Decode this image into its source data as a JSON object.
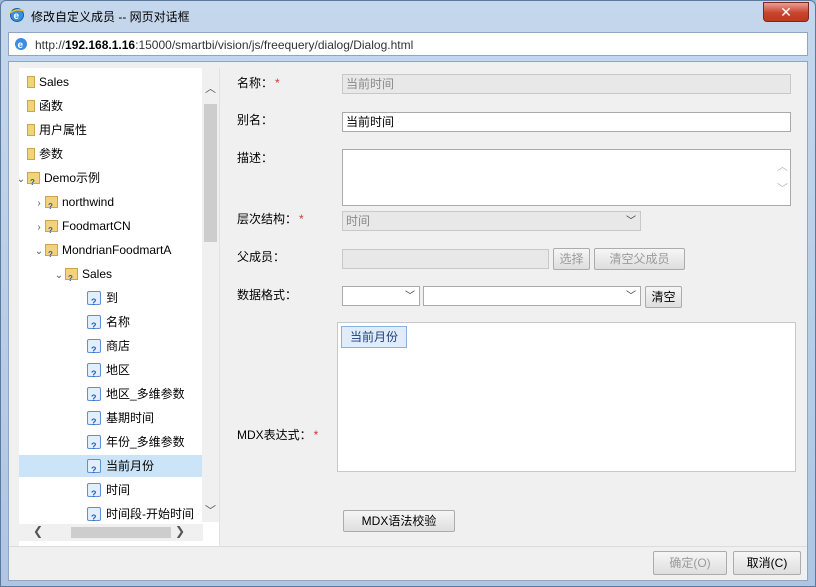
{
  "window": {
    "title": "修改自定义成员 -- 网页对话框",
    "close_label": "✕",
    "url_prefix": "http://",
    "url_host": "192.168.1.16",
    "url_path": ":15000/smartbi/vision/js/freequery/dialog/Dialog.html"
  },
  "tree": {
    "items": [
      {
        "label": "Sales",
        "level": 0,
        "icon": "small-folder-icon",
        "arrow": ""
      },
      {
        "label": "函数",
        "level": 0,
        "icon": "small-folder-icon",
        "arrow": ""
      },
      {
        "label": "用户属性",
        "level": 0,
        "icon": "small-folder-icon",
        "arrow": ""
      },
      {
        "label": "参数",
        "level": 0,
        "icon": "small-folder-icon",
        "arrow": ""
      },
      {
        "label": "Demo示例",
        "level": 0,
        "icon": "folder-icon",
        "arrow": "expanded"
      },
      {
        "label": "northwind",
        "level": 1,
        "icon": "folder-icon",
        "arrow": "collapsed"
      },
      {
        "label": "FoodmartCN",
        "level": 1,
        "icon": "folder-icon",
        "arrow": "collapsed"
      },
      {
        "label": "MondrianFoodmartA",
        "level": 1,
        "icon": "folder-icon",
        "arrow": "expanded"
      },
      {
        "label": "Sales",
        "level": 2,
        "icon": "folder-icon",
        "arrow": "expanded"
      },
      {
        "label": "到",
        "level": 3,
        "icon": "member-icon",
        "arrow": ""
      },
      {
        "label": "名称",
        "level": 3,
        "icon": "member-icon",
        "arrow": ""
      },
      {
        "label": "商店",
        "level": 3,
        "icon": "member-icon",
        "arrow": ""
      },
      {
        "label": "地区",
        "level": 3,
        "icon": "member-icon",
        "arrow": ""
      },
      {
        "label": "地区_多维参数",
        "level": 3,
        "icon": "member-icon",
        "arrow": ""
      },
      {
        "label": "基期时间",
        "level": 3,
        "icon": "member-icon",
        "arrow": ""
      },
      {
        "label": "年份_多维参数",
        "level": 3,
        "icon": "member-icon",
        "arrow": ""
      },
      {
        "label": "当前月份",
        "level": 3,
        "icon": "member-icon",
        "arrow": "",
        "selected": true
      },
      {
        "label": "时间",
        "level": 3,
        "icon": "member-icon",
        "arrow": ""
      },
      {
        "label": "时间段-开始时间",
        "level": 3,
        "icon": "member-icon",
        "arrow": ""
      }
    ]
  },
  "form": {
    "name_label": "名称：",
    "name_value": "当前时间",
    "alias_label": "别名：",
    "alias_value": "当前时间",
    "desc_label": "描述：",
    "desc_value": "",
    "hierarchy_label": "层次结构：",
    "hierarchy_value": "时间",
    "parent_label": "父成员：",
    "parent_value": "",
    "select_button": "选择",
    "clear_parent_button": "清空父成员",
    "format_label": "数据格式：",
    "format_value_1": "",
    "format_value_2": "",
    "clear_button": "清空",
    "mdx_label": "MDX表达式：",
    "mdx_tag": "当前月份",
    "mdx_check_button": "MDX语法校验",
    "required_mark": "*"
  },
  "footer": {
    "ok_button": "确定(O)",
    "cancel_button": "取消(C)"
  }
}
